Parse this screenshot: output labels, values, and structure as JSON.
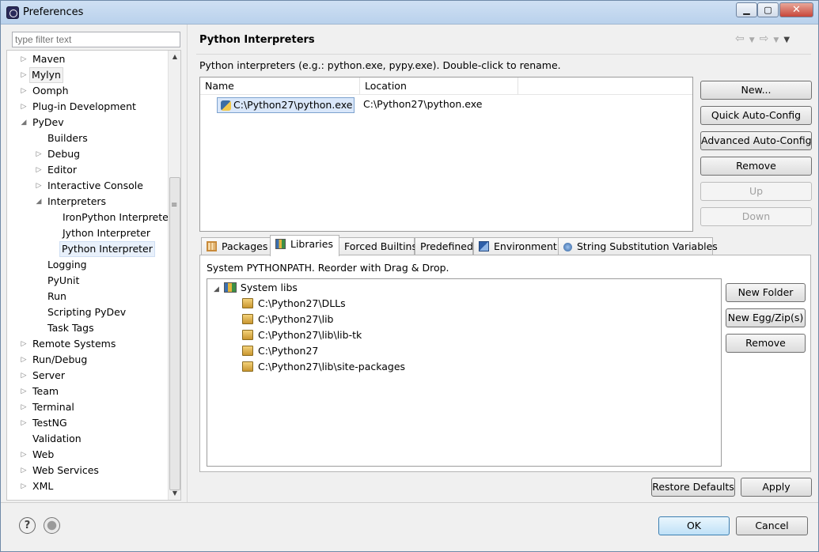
{
  "window": {
    "title": "Preferences",
    "controls": {
      "minimize": "▁",
      "maximize": "▢",
      "close": "✕"
    }
  },
  "filter": {
    "placeholder": "type filter text"
  },
  "tree": {
    "items": [
      {
        "label": "Maven",
        "twisty": "▷"
      },
      {
        "label": "Mylyn",
        "twisty": "▷"
      },
      {
        "label": "Oomph",
        "twisty": "▷"
      },
      {
        "label": "Plug-in Development",
        "twisty": "▷"
      },
      {
        "label": "PyDev",
        "twisty": "◢"
      },
      {
        "label": "Builders",
        "twisty": ""
      },
      {
        "label": "Debug",
        "twisty": "▷"
      },
      {
        "label": "Editor",
        "twisty": "▷"
      },
      {
        "label": "Interactive Console",
        "twisty": "▷"
      },
      {
        "label": "Interpreters",
        "twisty": "◢"
      },
      {
        "label": "IronPython Interpreter",
        "twisty": ""
      },
      {
        "label": "Jython Interpreter",
        "twisty": ""
      },
      {
        "label": "Python Interpreter",
        "twisty": ""
      },
      {
        "label": "Logging",
        "twisty": ""
      },
      {
        "label": "PyUnit",
        "twisty": ""
      },
      {
        "label": "Run",
        "twisty": ""
      },
      {
        "label": "Scripting PyDev",
        "twisty": ""
      },
      {
        "label": "Task Tags",
        "twisty": ""
      },
      {
        "label": "Remote Systems",
        "twisty": "▷"
      },
      {
        "label": "Run/Debug",
        "twisty": "▷"
      },
      {
        "label": "Server",
        "twisty": "▷"
      },
      {
        "label": "Team",
        "twisty": "▷"
      },
      {
        "label": "Terminal",
        "twisty": "▷"
      },
      {
        "label": "TestNG",
        "twisty": "▷"
      },
      {
        "label": "Validation",
        "twisty": ""
      },
      {
        "label": "Web",
        "twisty": "▷"
      },
      {
        "label": "Web Services",
        "twisty": "▷"
      },
      {
        "label": "XML",
        "twisty": "▷"
      }
    ]
  },
  "page": {
    "title": "Python Interpreters",
    "description": "Python interpreters (e.g.: python.exe, pypy.exe).   Double-click to rename.",
    "table": {
      "columns": [
        "Name",
        "Location"
      ],
      "rows": [
        {
          "name": "C:\\Python27\\python.exe",
          "location": "C:\\Python27\\python.exe"
        }
      ]
    },
    "buttons": {
      "new": "New...",
      "quick": "Quick Auto-Config",
      "advanced": "Advanced Auto-Config",
      "remove": "Remove",
      "up": "Up",
      "down": "Down"
    }
  },
  "tabs": [
    "Packages",
    "Libraries",
    "Forced Builtins",
    "Predefined",
    "Environment",
    "String Substitution Variables"
  ],
  "libraries": {
    "description": "System PYTHONPATH.   Reorder with Drag & Drop.",
    "root": "System libs",
    "paths": [
      "C:\\Python27\\DLLs",
      "C:\\Python27\\lib",
      "C:\\Python27\\lib\\lib-tk",
      "C:\\Python27",
      "C:\\Python27\\lib\\site-packages"
    ],
    "buttons": {
      "new_folder": "New Folder",
      "new_egg": "New Egg/Zip(s)",
      "remove": "Remove"
    }
  },
  "page_buttons": {
    "restore": "Restore Defaults",
    "apply": "Apply"
  },
  "dialog_buttons": {
    "ok": "OK",
    "cancel": "Cancel"
  },
  "footer": {
    "help": "?"
  }
}
